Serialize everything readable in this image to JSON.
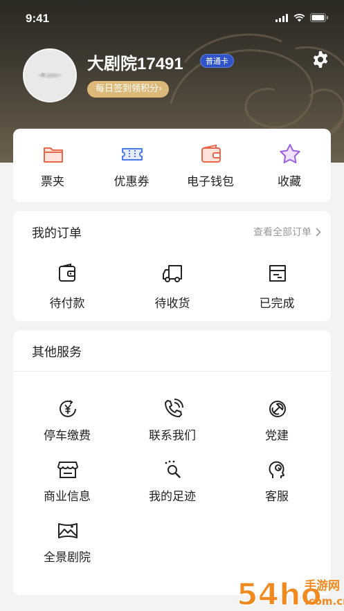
{
  "status_bar": {
    "time": "9:41"
  },
  "profile": {
    "username": "大剧院17491",
    "member_level": "普通卡",
    "daily_signin": "每日签到领积分",
    "daily_signin_arrow": "›"
  },
  "quick_actions": [
    {
      "label": "票夹",
      "icon": "folder-icon"
    },
    {
      "label": "优惠券",
      "icon": "ticket-icon"
    },
    {
      "label": "电子钱包",
      "icon": "wallet-icon"
    },
    {
      "label": "收藏",
      "icon": "star-icon"
    }
  ],
  "orders": {
    "title": "我的订单",
    "view_all": "查看全部订单",
    "items": [
      {
        "label": "待付款",
        "icon": "wallet-payment-icon"
      },
      {
        "label": "待收货",
        "icon": "delivery-truck-icon"
      },
      {
        "label": "已完成",
        "icon": "completed-box-icon"
      }
    ]
  },
  "services": {
    "title": "其他服务",
    "items": [
      {
        "label": "停车缴费",
        "icon": "parking-fee-icon"
      },
      {
        "label": "联系我们",
        "icon": "phone-icon"
      },
      {
        "label": "党建",
        "icon": "party-emblem-icon"
      },
      {
        "label": "商业信息",
        "icon": "storefront-icon"
      },
      {
        "label": "我的足迹",
        "icon": "footprint-icon"
      },
      {
        "label": "客服",
        "icon": "customer-service-icon"
      },
      {
        "label": "全景剧院",
        "icon": "panorama-icon"
      }
    ]
  },
  "watermark": {
    "text": "54ho",
    "brand": "手游网",
    "domain": ".com.cn"
  },
  "colors": {
    "header_dark": "#2a2822",
    "member_badge": "#2e54c8",
    "signin_gold": "#dcb979",
    "accent_red": "#e8674a",
    "accent_blue": "#4a78e8",
    "accent_purple": "#9b5fe0",
    "watermark_orange": "#f08a1e"
  }
}
